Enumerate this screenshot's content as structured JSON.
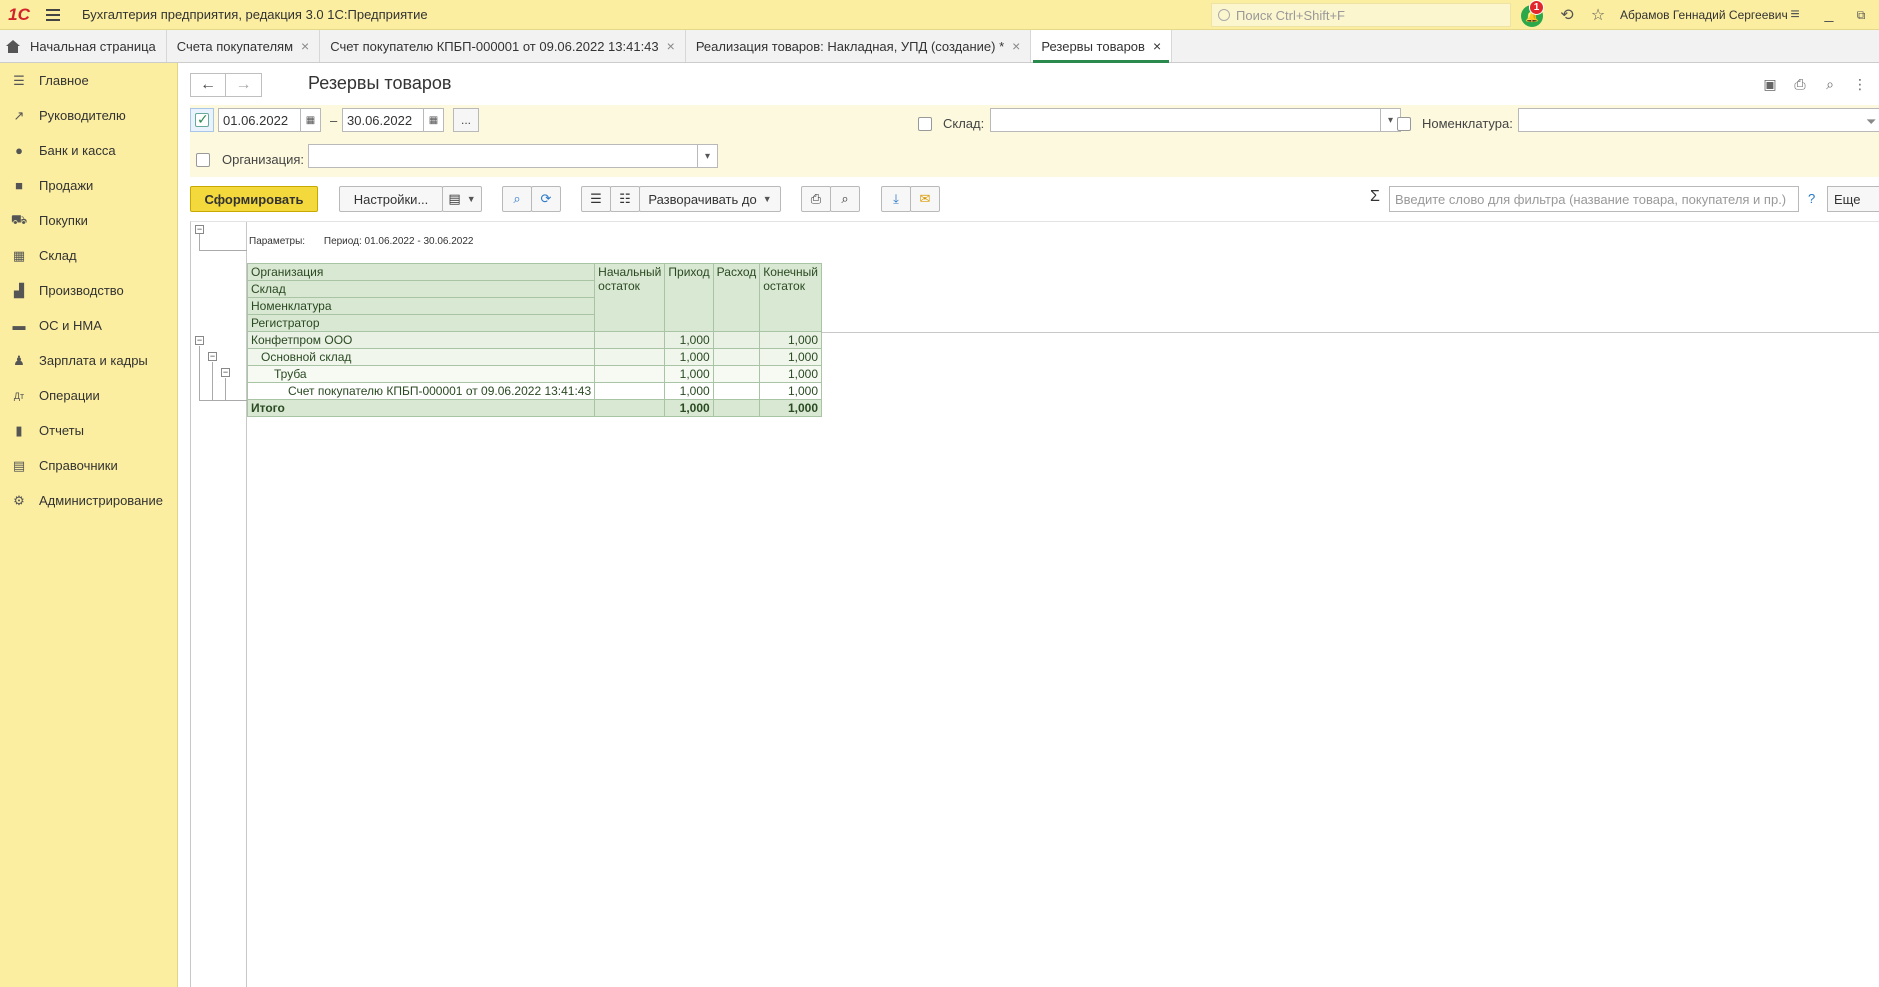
{
  "app": {
    "title": "Бухгалтерия предприятия, редакция 3.0 1С:Предприятие",
    "logo": "1С",
    "search_placeholder": "Поиск Ctrl+Shift+F",
    "notifications_count": "1",
    "user": "Абрамов Геннадий Сергеевич"
  },
  "tabs": [
    {
      "label": "Начальная страница"
    },
    {
      "label": "Счета покупателям"
    },
    {
      "label": "Счет покупателю КПБП-000001 от 09.06.2022 13:41:43"
    },
    {
      "label": "Реализация товаров: Накладная, УПД (создание) *"
    },
    {
      "label": "Резервы товаров"
    }
  ],
  "sidebar": {
    "items": [
      {
        "label": "Главное",
        "icon": "menu-icon"
      },
      {
        "label": "Руководителю",
        "icon": "chart-line-icon"
      },
      {
        "label": "Банк и касса",
        "icon": "coin-icon"
      },
      {
        "label": "Продажи",
        "icon": "bag-icon"
      },
      {
        "label": "Покупки",
        "icon": "cart-icon"
      },
      {
        "label": "Склад",
        "icon": "grid-icon"
      },
      {
        "label": "Производство",
        "icon": "factory-icon"
      },
      {
        "label": "ОС и НМА",
        "icon": "truck-icon"
      },
      {
        "label": "Зарплата и кадры",
        "icon": "person-icon"
      },
      {
        "label": "Операции",
        "icon": "dt-kt-icon"
      },
      {
        "label": "Отчеты",
        "icon": "bar-chart-icon"
      },
      {
        "label": "Справочники",
        "icon": "books-icon"
      },
      {
        "label": "Администрирование",
        "icon": "gear-icon"
      }
    ]
  },
  "page": {
    "title": "Резервы товаров"
  },
  "filters": {
    "period_enabled": true,
    "date_from": "01.06.2022",
    "dash": "–",
    "date_to": "30.06.2022",
    "dots": "...",
    "warehouse_label": "Склад:",
    "warehouse_value": "",
    "nomenclature_label": "Номенклатура:",
    "nomenclature_value": "",
    "org_label": "Организация:",
    "org_value": ""
  },
  "toolbar": {
    "generate": "Сформировать",
    "settings": "Настройки...",
    "expand_to": "Разворачивать до",
    "filter_placeholder": "Введите слово для фильтра (название товара, покупателя и пр.)",
    "help": "?",
    "more": "Еще"
  },
  "report": {
    "params_label": "Параметры:",
    "period_text": "Период: 01.06.2022 - 30.06.2022",
    "header_groups": [
      "Организация",
      "Склад",
      "Номенклатура",
      "Регистратор"
    ],
    "columns": [
      "Начальный остаток",
      "Приход",
      "Расход",
      "Конечный остаток"
    ],
    "rows": [
      {
        "label": "Конфетпром ООО",
        "level": 1,
        "start": "",
        "in": "1,000",
        "out": "",
        "end": "1,000"
      },
      {
        "label": "Основной склад",
        "level": 2,
        "start": "",
        "in": "1,000",
        "out": "",
        "end": "1,000"
      },
      {
        "label": "Труба",
        "level": 3,
        "start": "",
        "in": "1,000",
        "out": "",
        "end": "1,000"
      },
      {
        "label": "Счет покупателю КПБП-000001 от 09.06.2022 13:41:43",
        "level": 4,
        "start": "",
        "in": "1,000",
        "out": "",
        "end": "1,000"
      }
    ],
    "total": {
      "label": "Итого",
      "start": "",
      "in": "1,000",
      "out": "",
      "end": "1,000"
    }
  },
  "colors": {
    "panel_yellow": "#fbeea0",
    "primary_button": "#f3d93b",
    "active_tab_accent": "#2a8a4e",
    "table_header": "#d9e8d2"
  }
}
